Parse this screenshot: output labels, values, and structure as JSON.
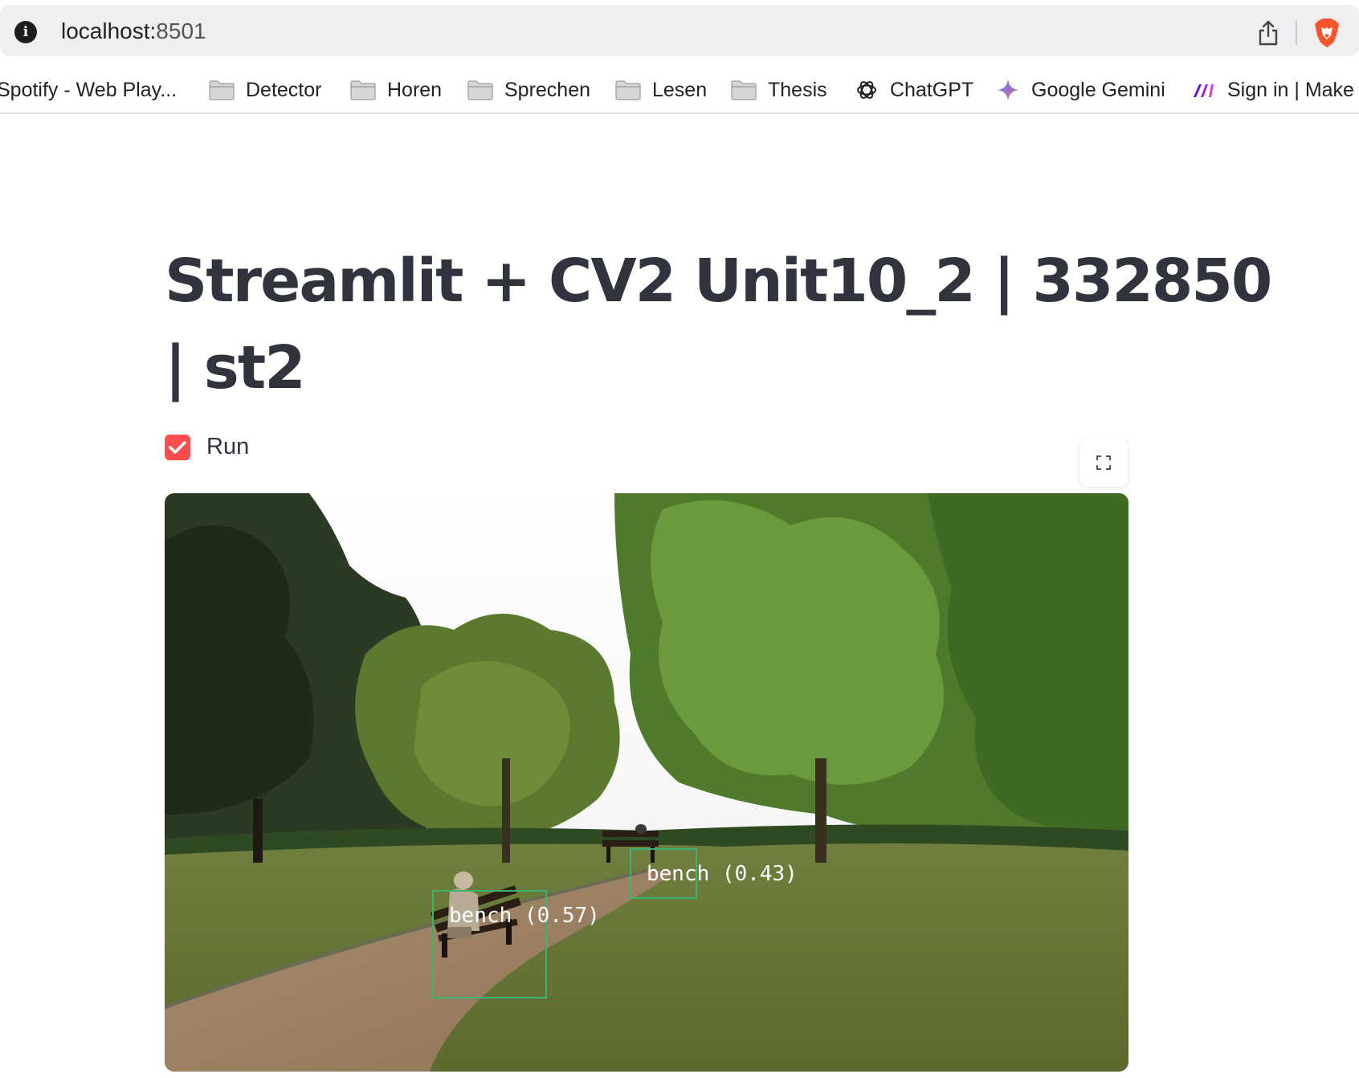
{
  "browser": {
    "url_host": "localhost:",
    "url_port": "8501",
    "bookmarks": [
      {
        "label": "Spotify - Web Play...",
        "icon": "spotify-icon"
      },
      {
        "label": "Detector",
        "icon": "folder-icon"
      },
      {
        "label": "Horen",
        "icon": "folder-icon"
      },
      {
        "label": "Sprechen",
        "icon": "folder-icon"
      },
      {
        "label": "Lesen",
        "icon": "folder-icon"
      },
      {
        "label": "Thesis",
        "icon": "folder-icon"
      },
      {
        "label": "ChatGPT",
        "icon": "chatgpt-icon"
      },
      {
        "label": "Google Gemini",
        "icon": "gemini-icon"
      },
      {
        "label": "Sign in | Make",
        "icon": "make-icon"
      }
    ]
  },
  "app": {
    "title": "Streamlit + CV2 Unit10_2 | 332850 | st2",
    "run_checkbox": {
      "label": "Run",
      "checked": true
    },
    "accent_color": "#ff4b4b",
    "frame": {
      "detections": [
        {
          "label": "bench (0.57)"
        },
        {
          "label": "bench (0.43)"
        }
      ]
    }
  }
}
